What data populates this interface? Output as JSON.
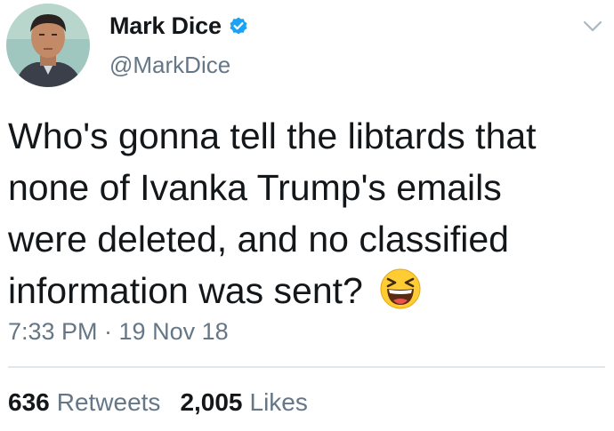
{
  "author": {
    "display_name": "Mark Dice",
    "handle": "@MarkDice",
    "verified": true,
    "avatar_icon": "profile-photo"
  },
  "tweet": {
    "lines": [
      "Who's gonna tell the libtards that",
      "none of Ivanka Trump's emails",
      "were deleted, and no classified",
      "information was sent?"
    ],
    "emoji_icon": "laughing-squinting-face-icon",
    "timestamp": "7:33 PM · 19 Nov 18"
  },
  "stats": {
    "retweets_count": "636",
    "retweets_label": "Retweets",
    "likes_count": "2,005",
    "likes_label": "Likes"
  },
  "colors": {
    "text": "#14171a",
    "secondary": "#657786",
    "verified_blue": "#1da1f2",
    "divider": "#e1e8ed"
  }
}
